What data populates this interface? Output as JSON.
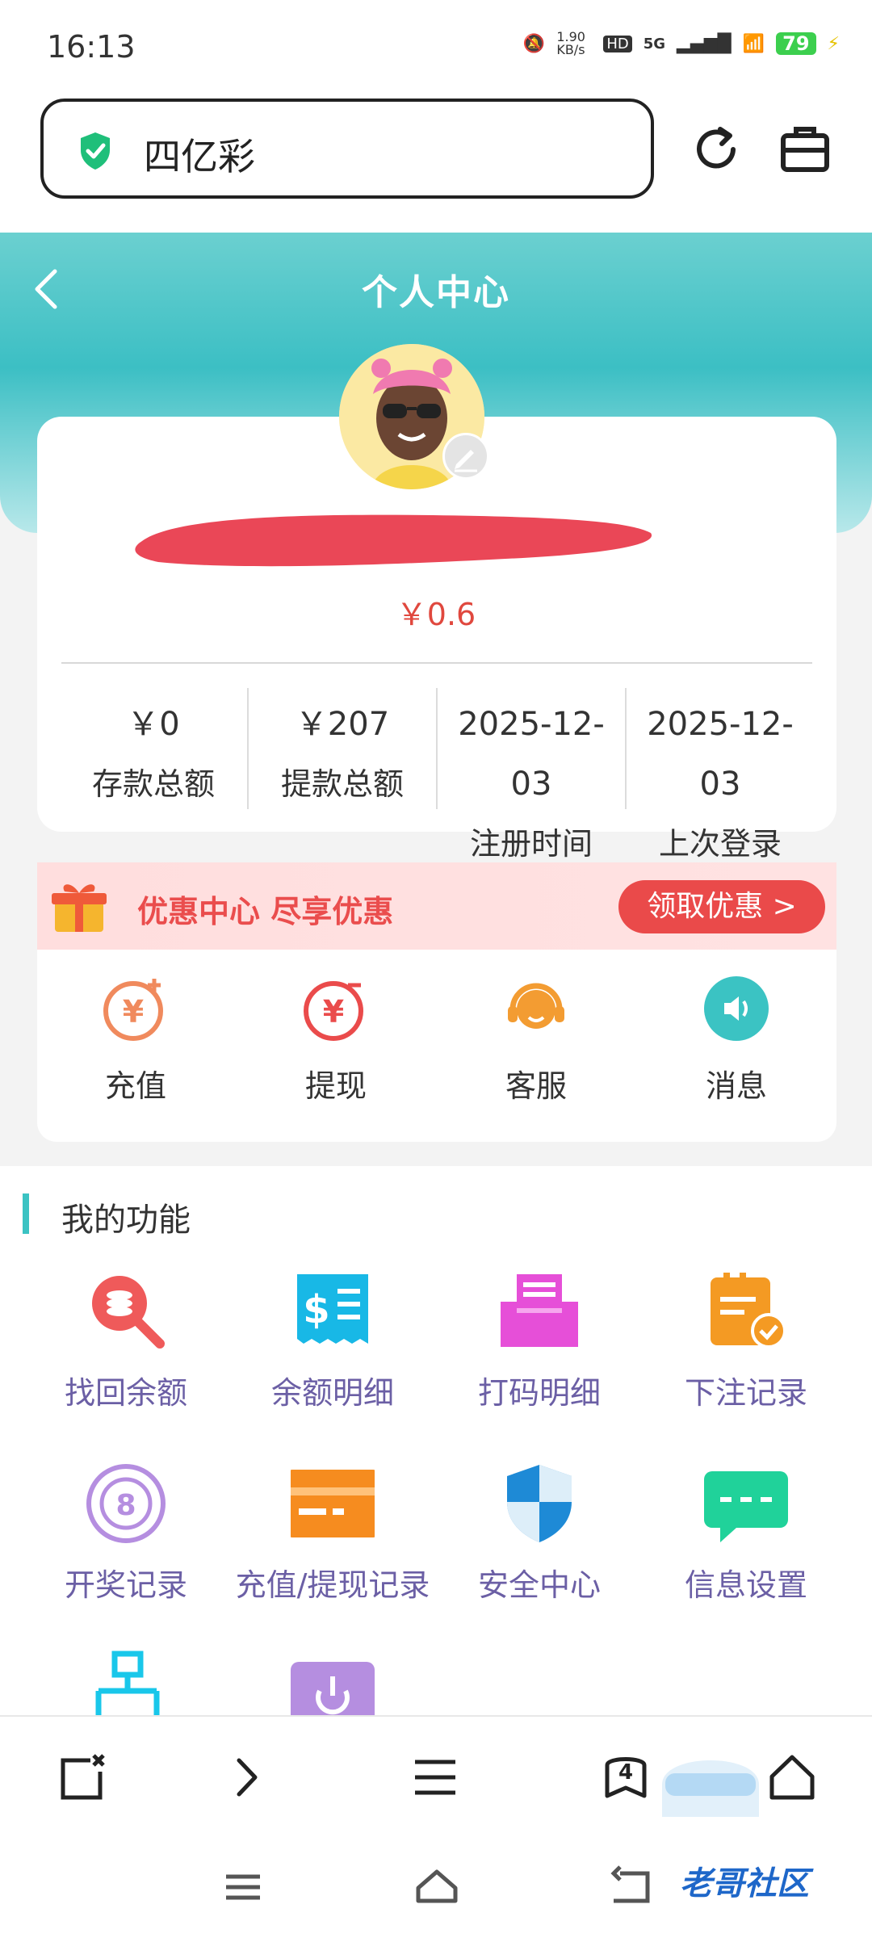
{
  "status_bar": {
    "time": "16:13",
    "net_speed": "1.90 KB/s",
    "hd": "HD",
    "signal": "5G",
    "battery": "79"
  },
  "browser": {
    "url_text": "四亿彩"
  },
  "header": {
    "title": "个人中心"
  },
  "profile": {
    "balance": "￥0.6",
    "stats": [
      {
        "value": "￥0",
        "label": "存款总额"
      },
      {
        "value": "￥207",
        "label": "提款总额"
      },
      {
        "value": "2025-12-03",
        "label": "注册时间"
      },
      {
        "value": "2025-12-03",
        "label": "上次登录"
      }
    ]
  },
  "promo": {
    "text": "优惠中心 尽享优惠",
    "button": "领取优惠 >"
  },
  "quick_actions": [
    {
      "label": "充值",
      "icon": "recharge-yen-icon",
      "color": "#f08a5d"
    },
    {
      "label": "提现",
      "icon": "withdraw-yen-icon",
      "color": "#ea4b4b"
    },
    {
      "label": "客服",
      "icon": "headset-icon",
      "color": "#f39c32"
    },
    {
      "label": "消息",
      "icon": "speaker-icon",
      "color": "#3bc3c3"
    }
  ],
  "features": {
    "title": "我的功能",
    "items": [
      {
        "label": "找回余额",
        "icon": "search-coins-icon",
        "color": "#ef5a5a"
      },
      {
        "label": "余额明细",
        "icon": "receipt-dollar-icon",
        "color": "#18b8e6"
      },
      {
        "label": "打码明细",
        "icon": "printer-icon",
        "color": "#e64fd8"
      },
      {
        "label": "下注记录",
        "icon": "clipboard-check-icon",
        "color": "#f49a23"
      },
      {
        "label": "开奖记录",
        "icon": "ball-8-icon",
        "color": "#b58ee0"
      },
      {
        "label": "充值/提现记录",
        "icon": "card-icon",
        "color": "#f68c1f"
      },
      {
        "label": "安全中心",
        "icon": "shield-icon",
        "color": "#1e8ad6"
      },
      {
        "label": "信息设置",
        "icon": "chat-icon",
        "color": "#20d29a"
      }
    ]
  },
  "browser_nav": {
    "tabs_count": "4"
  },
  "watermark": "老哥社区"
}
